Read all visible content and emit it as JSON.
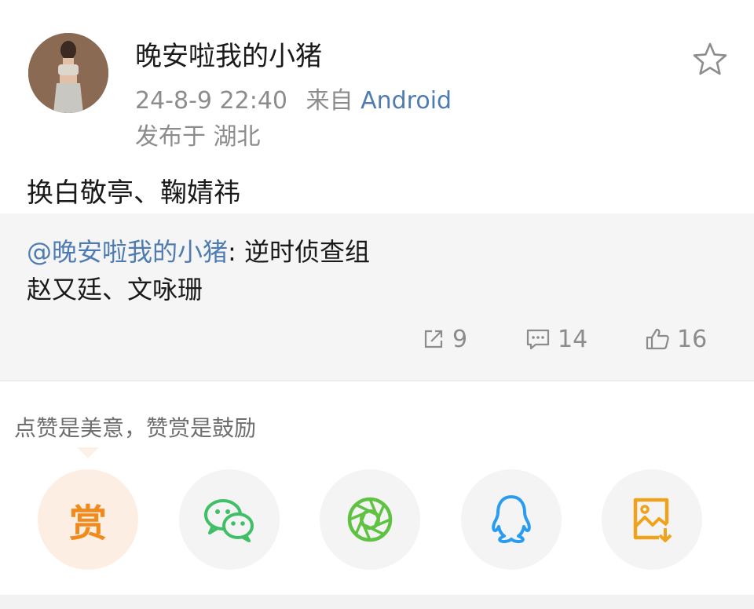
{
  "post": {
    "username": "晚安啦我的小猪",
    "time": "24-8-9 22:40",
    "source_prefix": "来自",
    "source": "Android",
    "location": "发布于 湖北",
    "text": "换白敬亭、鞠婧祎"
  },
  "repost": {
    "mention": "@晚安啦我的小猪",
    "separator": ":",
    "line1_text": " 逆时侦查组",
    "line2_text": "赵又廷、文咏珊"
  },
  "stats": {
    "reposts": "9",
    "comments": "14",
    "likes": "16"
  },
  "tip": "点赞是美意，赞赏是鼓励",
  "share": {
    "reward_label": "赏",
    "items": [
      "reward",
      "wechat-icon",
      "moments-icon",
      "qq-icon",
      "save-image-icon"
    ]
  },
  "colors": {
    "link": "#4f7bb3",
    "reward": "#f08a1c",
    "wechat": "#3fbf66",
    "moments": "#5fc243",
    "qq": "#2a9cf0",
    "save": "#f0a21c"
  }
}
